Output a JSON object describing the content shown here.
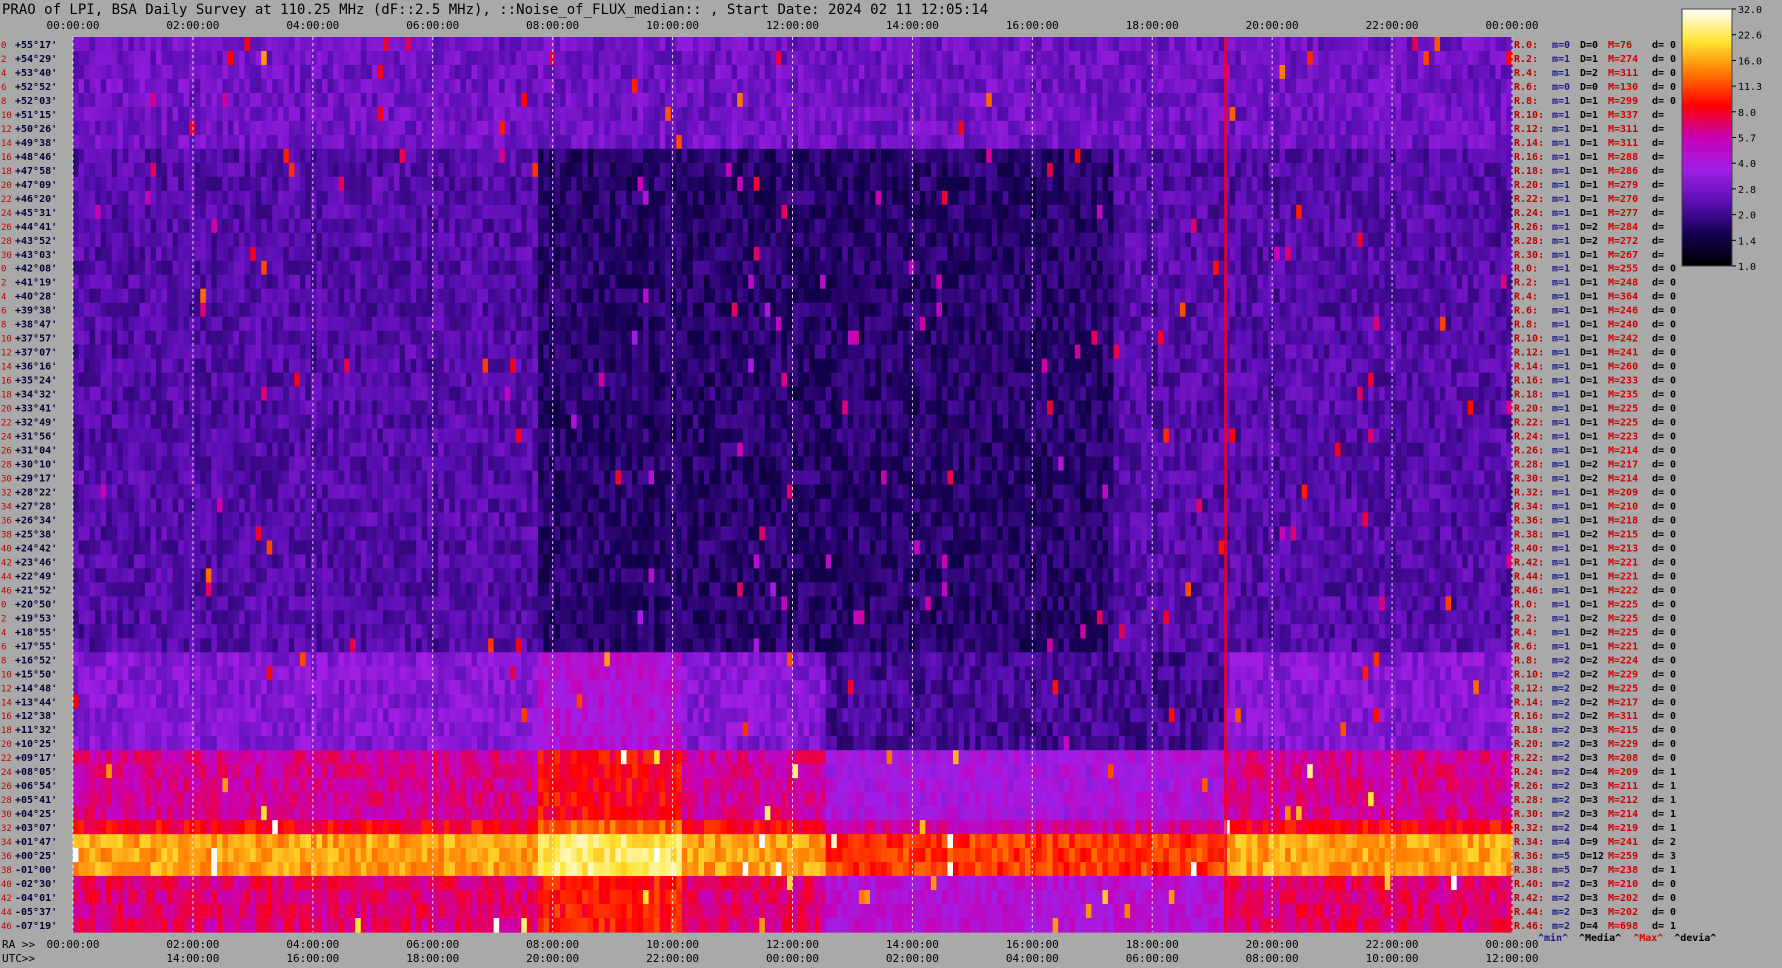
{
  "title": "PRAO of LPI, BSA Daily Survey at 110.25 MHz (dF::2.5 MHz), ::Noise_of_FLUX_median:: , Start Date: 2024 02 11 12:05:14",
  "chart_data": {
    "type": "heatmap",
    "title": "PRAO of LPI, BSA Daily Survey at 110.25 MHz (dF::2.5 MHz), ::Noise_of_FLUX_median:: , Start Date: 2024 02 11 12:05:14",
    "xlabel_ra": "RA >>",
    "xlabel_utc": "UTC>>",
    "x_ticks_top": [
      "00:00:00",
      "02:00:00",
      "04:00:00",
      "06:00:00",
      "08:00:00",
      "10:00:00",
      "12:00:00",
      "14:00:00",
      "16:00:00",
      "18:00:00",
      "20:00:00",
      "22:00:00",
      "00:00:00"
    ],
    "x_ticks_ra": [
      "00:00:00",
      "02:00:00",
      "04:00:00",
      "06:00:00",
      "08:00:00",
      "10:00:00",
      "12:00:00",
      "14:00:00",
      "16:00:00",
      "18:00:00",
      "20:00:00",
      "22:00:00",
      "00:00:00"
    ],
    "x_ticks_utc": [
      "14:00:00",
      "16:00:00",
      "18:00:00",
      "20:00:00",
      "22:00:00",
      "00:00:00",
      "02:00:00",
      "04:00:00",
      "06:00:00",
      "08:00:00",
      "10:00:00",
      "12:00:00"
    ],
    "y_labels": [
      "+55°17'",
      "+54°29'",
      "+53°40'",
      "+52°52'",
      "+52°03'",
      "+51°15'",
      "+50°26'",
      "+49°38'",
      "+48°46'",
      "+47°58'",
      "+47°09'",
      "+46°20'",
      "+45°31'",
      "+44°41'",
      "+43°52'",
      "+43°03'",
      "+42°08'",
      "+41°19'",
      "+40°28'",
      "+39°38'",
      "+38°47'",
      "+37°57'",
      "+37°07'",
      "+36°16'",
      "+35°24'",
      "+34°32'",
      "+33°41'",
      "+32°49'",
      "+31°56'",
      "+31°04'",
      "+30°10'",
      "+29°17'",
      "+28°22'",
      "+27°28'",
      "+26°34'",
      "+25°38'",
      "+24°42'",
      "+23°46'",
      "+22°49'",
      "+21°52'",
      "+20°50'",
      "+19°53'",
      "+18°55'",
      "+17°55'",
      "+16°52'",
      "+15°50'",
      "+14°48'",
      "+13°44'",
      "+12°38'",
      "+11°32'",
      "+10°25'",
      "+09°17'",
      "+08°05'",
      "+06°54'",
      "+05°41'",
      "+04°25'",
      "+03°07'",
      "+01°47'",
      "+00°25'",
      "-01°00'",
      "-02°30'",
      "-04°01'",
      "-05°37'",
      "-07°19'"
    ],
    "row_index_labels": [
      "0",
      "2",
      "4",
      "6",
      "8",
      "10",
      "12",
      "14",
      "16",
      "18",
      "20",
      "22",
      "24",
      "26",
      "28",
      "30",
      "0",
      "2",
      "4",
      "6",
      "8",
      "10",
      "12",
      "14",
      "16",
      "18",
      "20",
      "22",
      "24",
      "26",
      "28",
      "30",
      "32",
      "34",
      "36",
      "38",
      "40",
      "42",
      "44",
      "46",
      "0",
      "2",
      "4",
      "6",
      "8",
      "10",
      "12",
      "14",
      "16",
      "18",
      "20",
      "22",
      "24",
      "26",
      "28",
      "30",
      "32",
      "34",
      "36",
      "38",
      "40",
      "42",
      "44",
      "46"
    ],
    "colorbar": {
      "ticks": [
        "32.0",
        "22.6",
        "16.0",
        "11.3",
        "8.0",
        "5.7",
        "4.0",
        "2.8",
        "2.0",
        "1.4",
        "1.0"
      ],
      "scale": "log",
      "colormap": [
        "#000000",
        "#140050",
        "#5a0fb4",
        "#a01ee6",
        "#c800b4",
        "#ff0000",
        "#ff7800",
        "#ffe632",
        "#ffffff"
      ]
    },
    "stats_rows": [
      {
        "r": "R.0:",
        "m": "m=0",
        "d": "D=0",
        "med": "M=76",
        "dev": "d= 0"
      },
      {
        "r": "R.2:",
        "m": "m=1",
        "d": "D=1",
        "med": "M=274",
        "dev": "d= 0"
      },
      {
        "r": "R.4:",
        "m": "m=1",
        "d": "D=2",
        "med": "M=311",
        "dev": "d= 0"
      },
      {
        "r": "R.6:",
        "m": "m=0",
        "d": "D=0",
        "med": "M=130",
        "dev": "d= 0"
      },
      {
        "r": "R.8:",
        "m": "m=1",
        "d": "D=1",
        "med": "M=299",
        "dev": "d= 0"
      },
      {
        "r": "R.10:",
        "m": "m=1",
        "d": "D=1",
        "med": "M=337",
        "dev": "d="
      },
      {
        "r": "R.12:",
        "m": "m=1",
        "d": "D=1",
        "med": "M=311",
        "dev": "d="
      },
      {
        "r": "R.14:",
        "m": "m=1",
        "d": "D=1",
        "med": "M=311",
        "dev": "d="
      },
      {
        "r": "R.16:",
        "m": "m=1",
        "d": "D=1",
        "med": "M=288",
        "dev": "d="
      },
      {
        "r": "R.18:",
        "m": "m=1",
        "d": "D=1",
        "med": "M=286",
        "dev": "d="
      },
      {
        "r": "R.20:",
        "m": "m=1",
        "d": "D=1",
        "med": "M=279",
        "dev": "d="
      },
      {
        "r": "R.22:",
        "m": "m=1",
        "d": "D=1",
        "med": "M=270",
        "dev": "d="
      },
      {
        "r": "R.24:",
        "m": "m=1",
        "d": "D=1",
        "med": "M=277",
        "dev": "d="
      },
      {
        "r": "R.26:",
        "m": "m=1",
        "d": "D=2",
        "med": "M=284",
        "dev": "d="
      },
      {
        "r": "R.28:",
        "m": "m=1",
        "d": "D=2",
        "med": "M=272",
        "dev": "d="
      },
      {
        "r": "R.30:",
        "m": "m=1",
        "d": "D=1",
        "med": "M=267",
        "dev": "d="
      },
      {
        "r": "R.0:",
        "m": "m=1",
        "d": "D=1",
        "med": "M=255",
        "dev": "d= 0"
      },
      {
        "r": "R.2:",
        "m": "m=1",
        "d": "D=1",
        "med": "M=248",
        "dev": "d= 0"
      },
      {
        "r": "R.4:",
        "m": "m=1",
        "d": "D=1",
        "med": "M=364",
        "dev": "d= 0"
      },
      {
        "r": "R.6:",
        "m": "m=1",
        "d": "D=1",
        "med": "M=246",
        "dev": "d= 0"
      },
      {
        "r": "R.8:",
        "m": "m=1",
        "d": "D=1",
        "med": "M=240",
        "dev": "d= 0"
      },
      {
        "r": "R.10:",
        "m": "m=1",
        "d": "D=1",
        "med": "M=242",
        "dev": "d= 0"
      },
      {
        "r": "R.12:",
        "m": "m=1",
        "d": "D=1",
        "med": "M=241",
        "dev": "d= 0"
      },
      {
        "r": "R.14:",
        "m": "m=1",
        "d": "D=1",
        "med": "M=260",
        "dev": "d= 0"
      },
      {
        "r": "R.16:",
        "m": "m=1",
        "d": "D=1",
        "med": "M=233",
        "dev": "d= 0"
      },
      {
        "r": "R.18:",
        "m": "m=1",
        "d": "D=1",
        "med": "M=235",
        "dev": "d= 0"
      },
      {
        "r": "R.20:",
        "m": "m=1",
        "d": "D=1",
        "med": "M=225",
        "dev": "d= 0"
      },
      {
        "r": "R.22:",
        "m": "m=1",
        "d": "D=1",
        "med": "M=225",
        "dev": "d= 0"
      },
      {
        "r": "R.24:",
        "m": "m=1",
        "d": "D=1",
        "med": "M=223",
        "dev": "d= 0"
      },
      {
        "r": "R.26:",
        "m": "m=1",
        "d": "D=1",
        "med": "M=214",
        "dev": "d= 0"
      },
      {
        "r": "R.28:",
        "m": "m=1",
        "d": "D=2",
        "med": "M=217",
        "dev": "d= 0"
      },
      {
        "r": "R.30:",
        "m": "m=1",
        "d": "D=2",
        "med": "M=214",
        "dev": "d= 0"
      },
      {
        "r": "R.32:",
        "m": "m=1",
        "d": "D=1",
        "med": "M=209",
        "dev": "d= 0"
      },
      {
        "r": "R.34:",
        "m": "m=1",
        "d": "D=1",
        "med": "M=210",
        "dev": "d= 0"
      },
      {
        "r": "R.36:",
        "m": "m=1",
        "d": "D=1",
        "med": "M=218",
        "dev": "d= 0"
      },
      {
        "r": "R.38:",
        "m": "m=1",
        "d": "D=2",
        "med": "M=215",
        "dev": "d= 0"
      },
      {
        "r": "R.40:",
        "m": "m=1",
        "d": "D=1",
        "med": "M=213",
        "dev": "d= 0"
      },
      {
        "r": "R.42:",
        "m": "m=1",
        "d": "D=1",
        "med": "M=221",
        "dev": "d= 0"
      },
      {
        "r": "R.44:",
        "m": "m=1",
        "d": "D=1",
        "med": "M=221",
        "dev": "d= 0"
      },
      {
        "r": "R.46:",
        "m": "m=1",
        "d": "D=1",
        "med": "M=222",
        "dev": "d= 0"
      },
      {
        "r": "R.0:",
        "m": "m=1",
        "d": "D=1",
        "med": "M=225",
        "dev": "d= 0"
      },
      {
        "r": "R.2:",
        "m": "m=1",
        "d": "D=2",
        "med": "M=225",
        "dev": "d= 0"
      },
      {
        "r": "R.4:",
        "m": "m=1",
        "d": "D=2",
        "med": "M=225",
        "dev": "d= 0"
      },
      {
        "r": "R.6:",
        "m": "m=1",
        "d": "D=1",
        "med": "M=221",
        "dev": "d= 0"
      },
      {
        "r": "R.8:",
        "m": "m=2",
        "d": "D=2",
        "med": "M=224",
        "dev": "d= 0"
      },
      {
        "r": "R.10:",
        "m": "m=2",
        "d": "D=2",
        "med": "M=229",
        "dev": "d= 0"
      },
      {
        "r": "R.12:",
        "m": "m=2",
        "d": "D=2",
        "med": "M=225",
        "dev": "d= 0"
      },
      {
        "r": "R.14:",
        "m": "m=2",
        "d": "D=2",
        "med": "M=217",
        "dev": "d= 0"
      },
      {
        "r": "R.16:",
        "m": "m=2",
        "d": "D=2",
        "med": "M=311",
        "dev": "d= 0"
      },
      {
        "r": "R.18:",
        "m": "m=2",
        "d": "D=3",
        "med": "M=215",
        "dev": "d= 0"
      },
      {
        "r": "R.20:",
        "m": "m=2",
        "d": "D=3",
        "med": "M=229",
        "dev": "d= 0"
      },
      {
        "r": "R.22:",
        "m": "m=2",
        "d": "D=3",
        "med": "M=208",
        "dev": "d= 0"
      },
      {
        "r": "R.24:",
        "m": "m=2",
        "d": "D=4",
        "med": "M=209",
        "dev": "d= 1"
      },
      {
        "r": "R.26:",
        "m": "m=2",
        "d": "D=3",
        "med": "M=211",
        "dev": "d= 1"
      },
      {
        "r": "R.28:",
        "m": "m=2",
        "d": "D=3",
        "med": "M=212",
        "dev": "d= 1"
      },
      {
        "r": "R.30:",
        "m": "m=2",
        "d": "D=3",
        "med": "M=214",
        "dev": "d= 1"
      },
      {
        "r": "R.32:",
        "m": "m=2",
        "d": "D=4",
        "med": "M=219",
        "dev": "d= 1"
      },
      {
        "r": "R.34:",
        "m": "m=4",
        "d": "D=9",
        "med": "M=241",
        "dev": "d= 2"
      },
      {
        "r": "R.36:",
        "m": "m=5",
        "d": "D=12",
        "med": "M=259",
        "dev": "d= 3"
      },
      {
        "r": "R.38:",
        "m": "m=5",
        "d": "D=7",
        "med": "M=238",
        "dev": "d= 1"
      },
      {
        "r": "R.40:",
        "m": "m=2",
        "d": "D=3",
        "med": "M=210",
        "dev": "d= 0"
      },
      {
        "r": "R.42:",
        "m": "m=2",
        "d": "D=3",
        "med": "M=202",
        "dev": "d= 0"
      },
      {
        "r": "R.44:",
        "m": "m=2",
        "d": "D=3",
        "med": "M=202",
        "dev": "d= 0"
      },
      {
        "r": "R.46:",
        "m": "m=2",
        "d": "D=4",
        "med": "M=698",
        "dev": "d= 1"
      }
    ],
    "legend": [
      {
        "label": "^min^",
        "color": "#1a1a8c"
      },
      {
        "label": "^Media^",
        "color": "#000000"
      },
      {
        "label": "^Max^",
        "color": "#e00000"
      },
      {
        "label": "^devia^",
        "color": "#000000"
      }
    ],
    "grid": true
  }
}
